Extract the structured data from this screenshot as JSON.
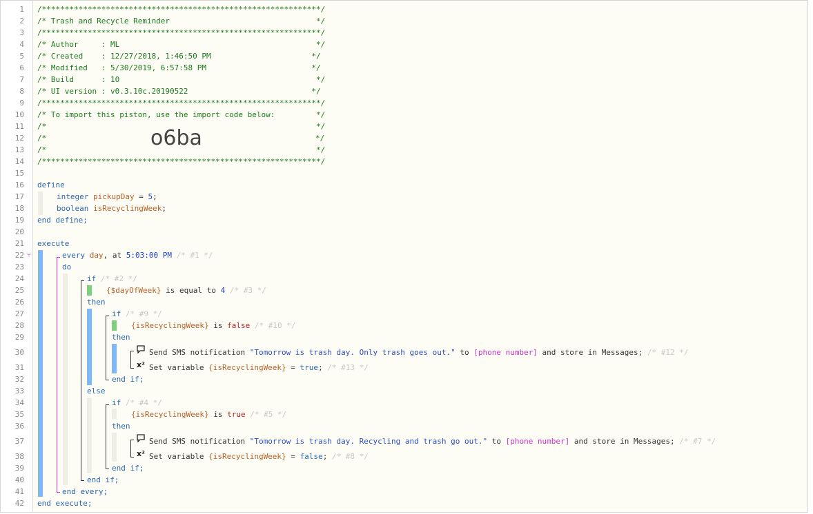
{
  "header": {
    "border": "/*************************************************************/",
    "title": "/* Trash and Recycle Reminder                                */",
    "author": "/* Author     : ML                                           */",
    "created": "/* Created    : 12/27/2018, 1:46:50 PM                      */",
    "modified": "/* Modified   : 5/30/2019, 6:57:58 PM                       */",
    "build": "/* Build      : 10                                           */",
    "ui_version": "/* UI version : v0.3.10c.20190522                           */",
    "import_note": "/* To import this piston, use the import code below:         */",
    "blank": "/*                                                           */",
    "blank_left": "/*",
    "blank_right": "*/",
    "import_code": "o6ba"
  },
  "line_numbers": [
    "1",
    "2",
    "3",
    "4",
    "5",
    "6",
    "7",
    "8",
    "9",
    "10",
    "11",
    "12",
    "13",
    "14",
    "15",
    "16",
    "17",
    "18",
    "19",
    "20",
    "21",
    "22",
    "23",
    "24",
    "25",
    "26",
    "27",
    "28",
    "29",
    "30",
    "31",
    "32",
    "33",
    "34",
    "35",
    "36",
    "37",
    "38",
    "39",
    "40",
    "41",
    "42"
  ],
  "define": {
    "open": "define",
    "var1_type": "integer",
    "var1_name": "pickupDay",
    "var1_eq": " = ",
    "var1_val": "5",
    "var1_end": ";",
    "var2_type": "boolean",
    "var2_name": "isRecyclingWeek",
    "var2_end": ";",
    "close": "end define;"
  },
  "execute": {
    "open": "execute",
    "every_kw": "every ",
    "every_day": "day",
    "every_at": ", at ",
    "every_time": "5:03:00 PM",
    "every_id": " /* #1 */",
    "do": "do",
    "if1_kw": "if",
    "if1_id": " /* #2 */",
    "cond1_var": "{$dayOfWeek}",
    "cond1_op": " is equal to ",
    "cond1_val": "4",
    "cond1_id": " /* #3 */",
    "then1": "then",
    "if2_kw": "if",
    "if2_id": " /* #9 */",
    "cond2_var": "{isRecyclingWeek}",
    "cond2_op": " is ",
    "cond2_val": "false",
    "cond2_id": " /* #10 */",
    "then2": "then",
    "sms1_pre": "Send SMS notification ",
    "sms1_msg": "\"Tomorrow is trash day. Only trash goes out.\"",
    "sms1_to": " to ",
    "sms1_phone": "[phone number]",
    "sms1_post": " and store in Messages;",
    "sms1_id": " /* #12 */",
    "set1_pre": "Set variable ",
    "set1_var": "{isRecyclingWeek}",
    "set1_eq": " = ",
    "set1_val": "true",
    "set1_end": ";",
    "set1_id": " /* #13 */",
    "endif2": "end if;",
    "else": "else",
    "if3_kw": "if",
    "if3_id": " /* #4 */",
    "cond3_var": "{isRecyclingWeek}",
    "cond3_op": " is ",
    "cond3_val": "true",
    "cond3_id": " /* #5 */",
    "then3": "then",
    "sms2_pre": "Send SMS notification ",
    "sms2_msg": "\"Tomorrow is trash day. Recycling and trash go out.\"",
    "sms2_to": " to ",
    "sms2_phone": "[phone number]",
    "sms2_post": " and store in Messages;",
    "sms2_id": " /* #7 */",
    "set2_pre": "Set variable ",
    "set2_var": "{isRecyclingWeek}",
    "set2_eq": " = ",
    "set2_val": "false",
    "set2_end": ";",
    "set2_id": " /* #8 */",
    "endif3": "end if;",
    "endif1": "end if;",
    "end_every": "end every;",
    "close": "end execute;"
  },
  "icons": {
    "comment": "speech-bubble-icon",
    "variable": "x-squared-icon",
    "variable_glyph": "x²",
    "marker": "fork-icon"
  },
  "colors": {
    "comment": "#1c7a1c",
    "keyword": "#2a66b0",
    "variable": "#b5602a",
    "device": "#c833c8",
    "bar_blue": "#7fb8f5",
    "bar_green": "#7ed07e"
  }
}
